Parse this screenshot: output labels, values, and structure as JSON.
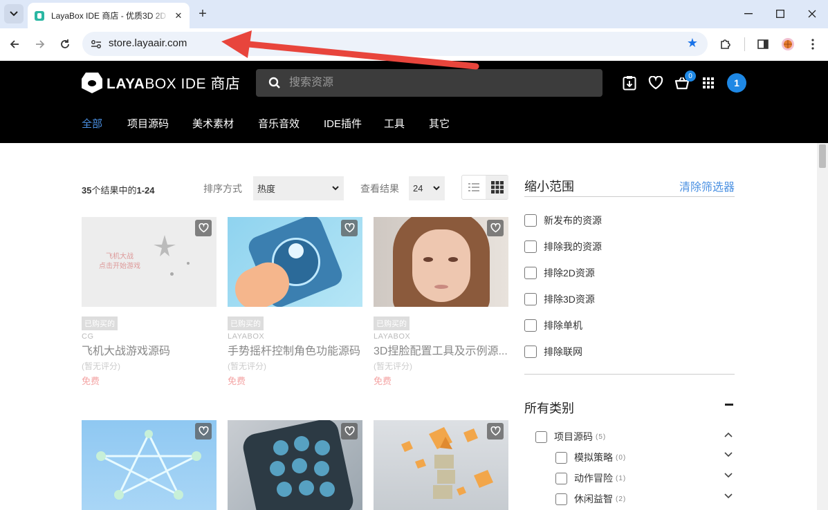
{
  "browser": {
    "tab_title": "LayaBox IDE 商店 - 优质3D 2D",
    "url": "store.layaair.com",
    "icons": {
      "tab_menu": "chevron-down-icon",
      "close": "close-icon",
      "new_tab": "plus-icon",
      "bookmark": "star-icon",
      "extensions": "puzzle-icon",
      "side_panel": "side-panel-icon",
      "menu": "kebab-menu-icon"
    }
  },
  "header": {
    "logo_bold": "LAYA",
    "logo_rest": "BOX IDE 商店",
    "search_placeholder": "搜索资源",
    "cart_count": "0",
    "user_initial": "1",
    "nav": [
      "全部",
      "项目源码",
      "美术素材",
      "音乐音效",
      "IDE插件",
      "工具",
      "其它"
    ],
    "active_nav": 0
  },
  "listing": {
    "results_count": "35",
    "results_text": "个结果中的",
    "results_range": "1-24",
    "sort_label": "排序方式",
    "sort_value": "热度",
    "view_label": "查看结果",
    "per_page_value": "24"
  },
  "products": [
    {
      "badge": "已购买的",
      "author": "CG",
      "title": "飞机大战游戏源码",
      "rating": "(暂无评分)",
      "price": "免费",
      "image": "plane-game-thumbnail",
      "image_text": [
        "飞机大战",
        "点击开始游戏"
      ]
    },
    {
      "badge": "已购买的",
      "author": "LAYABOX",
      "title": "手势摇杆控制角色功能源码",
      "rating": "(暂无评分)",
      "price": "免费",
      "image": "phone-joystick-thumbnail"
    },
    {
      "badge": "已购买的",
      "author": "LAYABOX",
      "title": "3D捏脸配置工具及示例源...",
      "rating": "(暂无评分)",
      "price": "免费",
      "image": "girl-face-thumbnail"
    },
    {
      "image": "star-puzzle-thumbnail"
    },
    {
      "image": "phone-buttons-thumbnail"
    },
    {
      "image": "floating-cubes-thumbnail"
    }
  ],
  "sidebar": {
    "narrow_title": "缩小范围",
    "clear_filters": "清除筛选器",
    "filters": [
      "新发布的资源",
      "排除我的资源",
      "排除2D资源",
      "排除3D资源",
      "排除单机",
      "排除联网"
    ],
    "categories_title": "所有类别",
    "categories": [
      {
        "label": "项目源码",
        "count": "(5)",
        "expanded": true
      },
      {
        "label": "模拟策略",
        "count": "(0)",
        "expanded": false
      },
      {
        "label": "动作冒险",
        "count": "(1)",
        "expanded": false
      },
      {
        "label": "休闲益智",
        "count": "(2)",
        "expanded": false
      }
    ]
  },
  "colors": {
    "accent": "#4a90e2",
    "badge_blue": "#1e88e5",
    "header_bg": "#000000",
    "price": "#f4a3a3",
    "annotation_arrow": "#e8453c"
  }
}
